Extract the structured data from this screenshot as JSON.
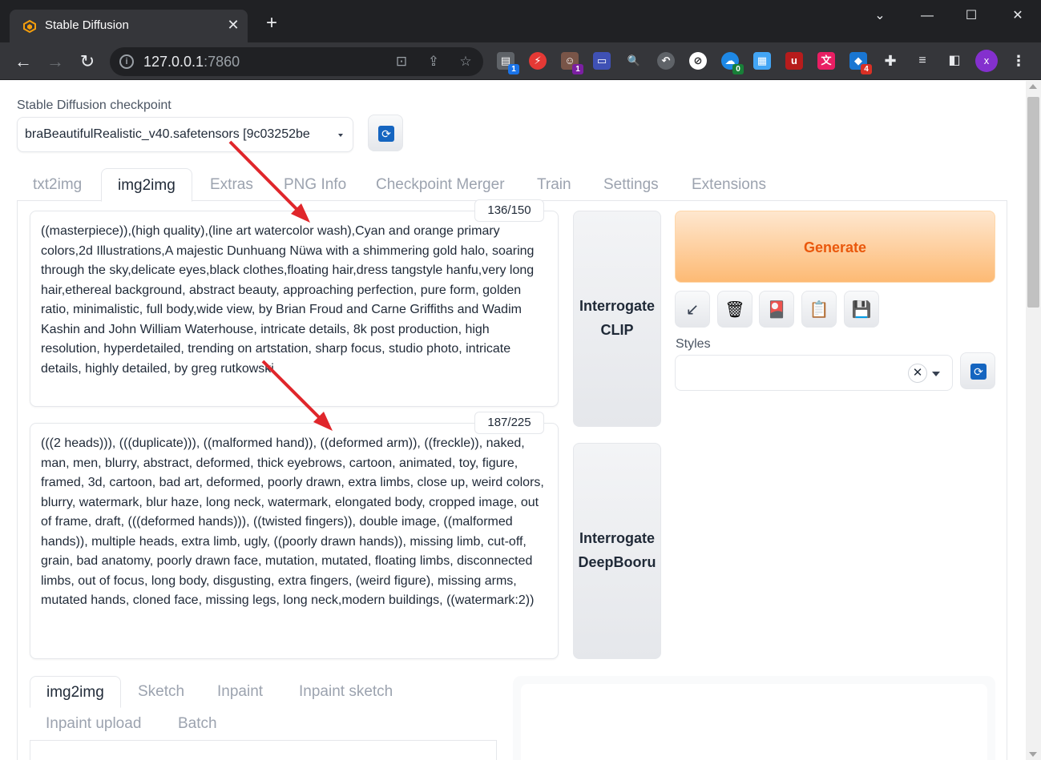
{
  "browser": {
    "tab_title": "Stable Diffusion",
    "url_host": "127.0.0.1",
    "url_port": ":7860",
    "profile_initial": "x",
    "extensions": [
      {
        "name": "ext-1",
        "badge": "1",
        "color": "#5f6368",
        "badge_color": "#1a73e8"
      },
      {
        "name": "ext-2",
        "badge": "",
        "color": "#e53935",
        "badge_color": ""
      },
      {
        "name": "ext-3",
        "badge": "1",
        "color": "#795548",
        "badge_color": "#7b1fa2"
      },
      {
        "name": "ext-4",
        "badge": "0",
        "color": "#5f6368",
        "badge_color": "#188038"
      },
      {
        "name": "ext-5",
        "badge": "4",
        "color": "#1976d2",
        "badge_color": "#d93025"
      }
    ]
  },
  "checkpoint": {
    "label": "Stable Diffusion checkpoint",
    "value": "braBeautifulRealistic_v40.safetensors [9c03252be"
  },
  "tabs": [
    {
      "label": "txt2img"
    },
    {
      "label": "img2img"
    },
    {
      "label": "Extras"
    },
    {
      "label": "PNG Info"
    },
    {
      "label": "Checkpoint Merger"
    },
    {
      "label": "Train"
    },
    {
      "label": "Settings"
    },
    {
      "label": "Extensions"
    }
  ],
  "prompt": {
    "text": "((masterpiece)),(high quality),(line art watercolor wash),Cyan and orange primary colors,2d Illustrations,A majestic Dunhuang Nüwa with a shimmering gold halo, soaring through the sky,delicate eyes,black clothes,floating hair,dress tangstyle hanfu,very long hair,ethereal background, abstract beauty, approaching perfection, pure form, golden ratio, minimalistic, full body,wide view, by Brian Froud and Carne Griffiths and Wadim Kashin and John William Waterhouse, intricate details, 8k post production, high resolution, hyperdetailed, trending on artstation, sharp focus, studio photo, intricate details, highly detailed, by greg rutkowski",
    "counter": "136/150"
  },
  "negative_prompt": {
    "text": "(((2 heads))), (((duplicate))), ((malformed hand)), ((deformed arm)), ((freckle)), naked, man, men, blurry, abstract, deformed, thick eyebrows, cartoon, animated, toy, figure, framed, 3d, cartoon, bad art, deformed, poorly drawn, extra limbs, close up, weird colors, blurry, watermark, blur haze, long neck, watermark, elongated body, cropped image, out of frame, draft, (((deformed hands))), ((twisted fingers)), double image, ((malformed hands)), multiple heads, extra limb, ugly, ((poorly drawn hands)), missing limb, cut-off, grain, bad anatomy, poorly drawn face, mutation, mutated, floating limbs, disconnected limbs, out of focus, long body, disgusting, extra fingers, (weird figure), missing arms, mutated hands, cloned face, missing legs, long neck,modern buildings, ((watermark:2))",
    "counter": "187/225"
  },
  "interrogate_clip": {
    "line1": "Interrogate",
    "line2": "CLIP"
  },
  "interrogate_deepbooru": {
    "line1": "Interrogate",
    "line2": "DeepBooru"
  },
  "generate_label": "Generate",
  "styles_label": "Styles",
  "sub_tabs": [
    {
      "label": "img2img"
    },
    {
      "label": "Sketch"
    },
    {
      "label": "Inpaint"
    },
    {
      "label": "Inpaint sketch"
    },
    {
      "label": "Inpaint upload"
    },
    {
      "label": "Batch"
    }
  ],
  "colors": {
    "generate_text": "#ea580c",
    "annotation_arrow": "#e0262b",
    "refresh_icon": "#1565c0"
  }
}
